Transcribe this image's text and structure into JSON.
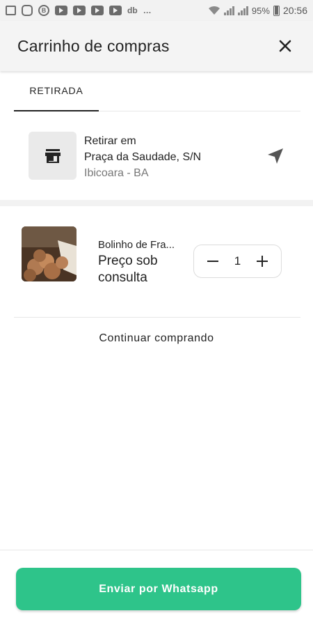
{
  "status_bar": {
    "battery": "95%",
    "time": "20:56",
    "app_icons": [
      "notes-icon",
      "instagram-icon",
      "b-icon",
      "youtube-icon",
      "youtube-icon",
      "youtube-icon",
      "youtube-icon",
      "db-icon"
    ],
    "b_glyph": "B",
    "db_glyph": "db",
    "more": "…"
  },
  "header": {
    "title": "Carrinho de compras",
    "close_icon": "close-icon"
  },
  "tabs": [
    {
      "label": "RETIRADA",
      "active": true
    }
  ],
  "pickup": {
    "label": "Retirar em",
    "address": "Praça da Saudade, S/N",
    "city": "Ibicoara - BA",
    "store_icon": "store-icon",
    "navigate_icon": "navigation-arrow-icon"
  },
  "cart": {
    "items": [
      {
        "name": "Bolinho de Fra...",
        "price": "Preço sob consulta",
        "quantity": "1"
      }
    ]
  },
  "actions": {
    "continue_label": "Continuar comprando",
    "send_label": "Enviar por Whatsapp"
  },
  "colors": {
    "accent": "#2ec48a",
    "header_bg": "#f4f4f4"
  }
}
